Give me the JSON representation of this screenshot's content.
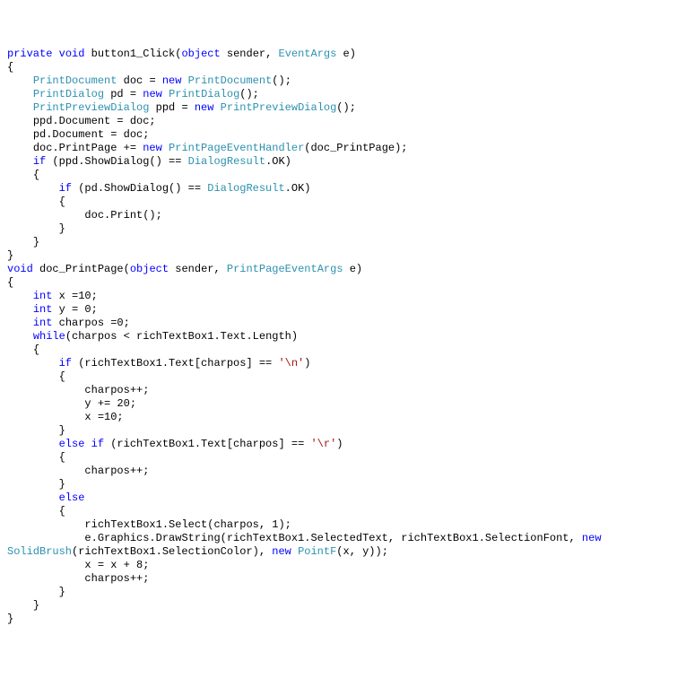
{
  "code": {
    "lines": [
      {
        "indent": 0,
        "tokens": [
          {
            "t": "private",
            "c": "kw"
          },
          {
            "t": " "
          },
          {
            "t": "void",
            "c": "kw"
          },
          {
            "t": " button1_Click("
          },
          {
            "t": "object",
            "c": "kw"
          },
          {
            "t": " sender, "
          },
          {
            "t": "EventArgs",
            "c": "type"
          },
          {
            "t": " e)"
          }
        ]
      },
      {
        "indent": 0,
        "tokens": [
          {
            "t": "{"
          }
        ]
      },
      {
        "indent": 1,
        "tokens": [
          {
            "t": "PrintDocument",
            "c": "type"
          },
          {
            "t": " doc = "
          },
          {
            "t": "new",
            "c": "kw"
          },
          {
            "t": " "
          },
          {
            "t": "PrintDocument",
            "c": "type"
          },
          {
            "t": "();"
          }
        ]
      },
      {
        "indent": 1,
        "tokens": [
          {
            "t": "PrintDialog",
            "c": "type"
          },
          {
            "t": " pd = "
          },
          {
            "t": "new",
            "c": "kw"
          },
          {
            "t": " "
          },
          {
            "t": "PrintDialog",
            "c": "type"
          },
          {
            "t": "();"
          }
        ]
      },
      {
        "indent": 1,
        "tokens": [
          {
            "t": "PrintPreviewDialog",
            "c": "type"
          },
          {
            "t": " ppd = "
          },
          {
            "t": "new",
            "c": "kw"
          },
          {
            "t": " "
          },
          {
            "t": "PrintPreviewDialog",
            "c": "type"
          },
          {
            "t": "();"
          }
        ]
      },
      {
        "indent": 1,
        "tokens": [
          {
            "t": "ppd.Document = doc;"
          }
        ]
      },
      {
        "indent": 1,
        "tokens": [
          {
            "t": "pd.Document = doc;"
          }
        ]
      },
      {
        "indent": 1,
        "tokens": [
          {
            "t": "doc.PrintPage += "
          },
          {
            "t": "new",
            "c": "kw"
          },
          {
            "t": " "
          },
          {
            "t": "PrintPageEventHandler",
            "c": "type"
          },
          {
            "t": "(doc_PrintPage);"
          }
        ]
      },
      {
        "indent": 1,
        "tokens": [
          {
            "t": "if",
            "c": "kw"
          },
          {
            "t": " (ppd.ShowDialog() == "
          },
          {
            "t": "DialogResult",
            "c": "type"
          },
          {
            "t": ".OK)"
          }
        ]
      },
      {
        "indent": 1,
        "tokens": [
          {
            "t": "{"
          }
        ]
      },
      {
        "indent": 2,
        "tokens": [
          {
            "t": "if",
            "c": "kw"
          },
          {
            "t": " (pd.ShowDialog() == "
          },
          {
            "t": "DialogResult",
            "c": "type"
          },
          {
            "t": ".OK)"
          }
        ]
      },
      {
        "indent": 2,
        "tokens": [
          {
            "t": "{"
          }
        ]
      },
      {
        "indent": 3,
        "tokens": [
          {
            "t": "doc.Print();"
          }
        ]
      },
      {
        "indent": 2,
        "tokens": [
          {
            "t": "}"
          }
        ]
      },
      {
        "indent": 1,
        "tokens": [
          {
            "t": "}"
          }
        ]
      },
      {
        "indent": 0,
        "tokens": [
          {
            "t": "}"
          }
        ]
      },
      {
        "indent": 0,
        "tokens": [
          {
            "t": "void",
            "c": "kw"
          },
          {
            "t": " doc_PrintPage("
          },
          {
            "t": "object",
            "c": "kw"
          },
          {
            "t": " sender, "
          },
          {
            "t": "PrintPageEventArgs",
            "c": "type"
          },
          {
            "t": " e)"
          }
        ]
      },
      {
        "indent": 0,
        "tokens": [
          {
            "t": "{"
          }
        ]
      },
      {
        "indent": 1,
        "tokens": [
          {
            "t": "int",
            "c": "kw"
          },
          {
            "t": " x =10;"
          }
        ]
      },
      {
        "indent": 1,
        "tokens": [
          {
            "t": "int",
            "c": "kw"
          },
          {
            "t": " y = 0;"
          }
        ]
      },
      {
        "indent": 1,
        "tokens": [
          {
            "t": "int",
            "c": "kw"
          },
          {
            "t": " charpos =0;"
          }
        ]
      },
      {
        "indent": 1,
        "tokens": [
          {
            "t": "while",
            "c": "kw"
          },
          {
            "t": "(charpos < richTextBox1.Text.Length)"
          }
        ]
      },
      {
        "indent": 1,
        "tokens": [
          {
            "t": "{"
          }
        ]
      },
      {
        "indent": 2,
        "tokens": [
          {
            "t": "if",
            "c": "kw"
          },
          {
            "t": " (richTextBox1.Text[charpos] == "
          },
          {
            "t": "'\\n'",
            "c": "str"
          },
          {
            "t": ")"
          }
        ]
      },
      {
        "indent": 2,
        "tokens": [
          {
            "t": "{"
          }
        ]
      },
      {
        "indent": 3,
        "tokens": [
          {
            "t": "charpos++;"
          }
        ]
      },
      {
        "indent": 3,
        "tokens": [
          {
            "t": "y += 20;"
          }
        ]
      },
      {
        "indent": 3,
        "tokens": [
          {
            "t": "x =10;"
          }
        ]
      },
      {
        "indent": 2,
        "tokens": [
          {
            "t": "}"
          }
        ]
      },
      {
        "indent": 2,
        "tokens": [
          {
            "t": "else",
            "c": "kw"
          },
          {
            "t": " "
          },
          {
            "t": "if",
            "c": "kw"
          },
          {
            "t": " (richTextBox1.Text[charpos] == "
          },
          {
            "t": "'\\r'",
            "c": "str"
          },
          {
            "t": ")"
          }
        ]
      },
      {
        "indent": 2,
        "tokens": [
          {
            "t": "{"
          }
        ]
      },
      {
        "indent": 3,
        "tokens": [
          {
            "t": "charpos++;"
          }
        ]
      },
      {
        "indent": 2,
        "tokens": [
          {
            "t": "}"
          }
        ]
      },
      {
        "indent": 2,
        "tokens": [
          {
            "t": "else",
            "c": "kw"
          }
        ]
      },
      {
        "indent": 2,
        "tokens": [
          {
            "t": "{"
          }
        ]
      },
      {
        "indent": 3,
        "tokens": [
          {
            "t": "richTextBox1.Select(charpos, 1);"
          }
        ]
      },
      {
        "indent": 3,
        "tokens": [
          {
            "t": "e.Graphics.DrawString(richTextBox1.SelectedText, richTextBox1.SelectionFont, "
          },
          {
            "t": "new",
            "c": "kw"
          },
          {
            "t": " "
          }
        ]
      },
      {
        "indent": 0,
        "tokens": [
          {
            "t": "SolidBrush",
            "c": "type"
          },
          {
            "t": "(richTextBox1.SelectionColor), "
          },
          {
            "t": "new",
            "c": "kw"
          },
          {
            "t": " "
          },
          {
            "t": "PointF",
            "c": "type"
          },
          {
            "t": "(x, y));"
          }
        ]
      },
      {
        "indent": 3,
        "tokens": [
          {
            "t": "x = x + 8;"
          }
        ]
      },
      {
        "indent": 3,
        "tokens": [
          {
            "t": "charpos++;"
          }
        ]
      },
      {
        "indent": 2,
        "tokens": [
          {
            "t": "}"
          }
        ]
      },
      {
        "indent": 1,
        "tokens": [
          {
            "t": "}"
          }
        ]
      },
      {
        "indent": 0,
        "tokens": [
          {
            "t": "}"
          }
        ]
      }
    ]
  }
}
